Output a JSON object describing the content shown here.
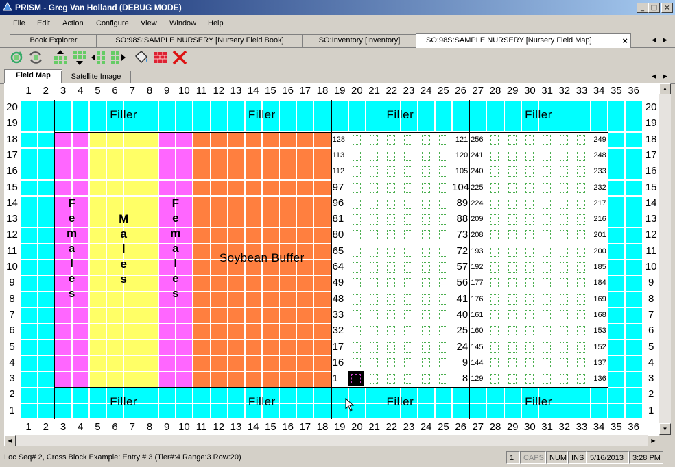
{
  "window": {
    "title": "PRISM - Greg Van Holland (DEBUG MODE)",
    "controls": {
      "minimize": "_",
      "maximize": "□",
      "close": "×"
    }
  },
  "menu": [
    "File",
    "Edit",
    "Action",
    "Configure",
    "View",
    "Window",
    "Help"
  ],
  "tabs": [
    {
      "label": "Book Explorer"
    },
    {
      "label": "SO:98S:SAMPLE NURSERY [Nursery Field Book]"
    },
    {
      "label": "SO:Inventory [Inventory]"
    },
    {
      "label": "SO:98S:SAMPLE NURSERY [Nursery Field Map]",
      "active": true,
      "close": "×"
    }
  ],
  "toolbar": [
    "refresh-icon",
    "swap-icon",
    "move-up-icon",
    "move-down-icon",
    "move-left-icon",
    "move-right-icon",
    "paint-bucket-icon",
    "brick-wall-icon",
    "delete-icon"
  ],
  "subtabs": [
    {
      "label": "Field Map",
      "active": true
    },
    {
      "label": "Satellite Image"
    }
  ],
  "field_map": {
    "columns": [
      "1",
      "2",
      "3",
      "4",
      "5",
      "6",
      "7",
      "8",
      "9",
      "10",
      "11",
      "12",
      "13",
      "14",
      "15",
      "16",
      "17",
      "18",
      "19",
      "20",
      "21",
      "22",
      "23",
      "24",
      "25",
      "26",
      "27",
      "28",
      "29",
      "30",
      "31",
      "32",
      "33",
      "34",
      "35",
      "36"
    ],
    "rows": [
      "20",
      "19",
      "18",
      "17",
      "16",
      "15",
      "14",
      "13",
      "12",
      "11",
      "10",
      "9",
      "8",
      "7",
      "6",
      "5",
      "4",
      "3",
      "2",
      "1"
    ],
    "labels": {
      "filler": "Filler",
      "females": "Females",
      "males": "Males",
      "soybean": "Soybean Buffer"
    },
    "colors": {
      "filler": "#00ffff",
      "females": "#ff66ff",
      "males": "#ffff66",
      "soybean": "#ff7f3f",
      "plots": "#ffffff"
    },
    "plot_numbers": {
      "block1_left": [
        "128",
        "113",
        "112",
        "97",
        "96",
        "81",
        "80",
        "65",
        "64",
        "49",
        "48",
        "33",
        "32",
        "17",
        "16",
        "1"
      ],
      "block1_right": [
        "121",
        "120",
        "105",
        "104",
        "89",
        "88",
        "73",
        "72",
        "57",
        "56",
        "41",
        "40",
        "25",
        "24",
        "9",
        "8"
      ],
      "block2_left": [
        "256",
        "241",
        "240",
        "225",
        "224",
        "209",
        "208",
        "193",
        "192",
        "177",
        "176",
        "161",
        "160",
        "145",
        "144",
        "129"
      ],
      "block2_right": [
        "249",
        "248",
        "233",
        "232",
        "217",
        "216",
        "201",
        "200",
        "185",
        "184",
        "169",
        "168",
        "153",
        "152",
        "137",
        "136"
      ]
    }
  },
  "status": {
    "message": "Loc Seq# 2, Cross Block Example: Entry # 3   (Tier#:4  Range:3 Row:20)",
    "page": "1",
    "caps": "CAPS",
    "num": "NUM",
    "ins": "INS",
    "date": "5/16/2013",
    "time": "3:28 PM"
  }
}
